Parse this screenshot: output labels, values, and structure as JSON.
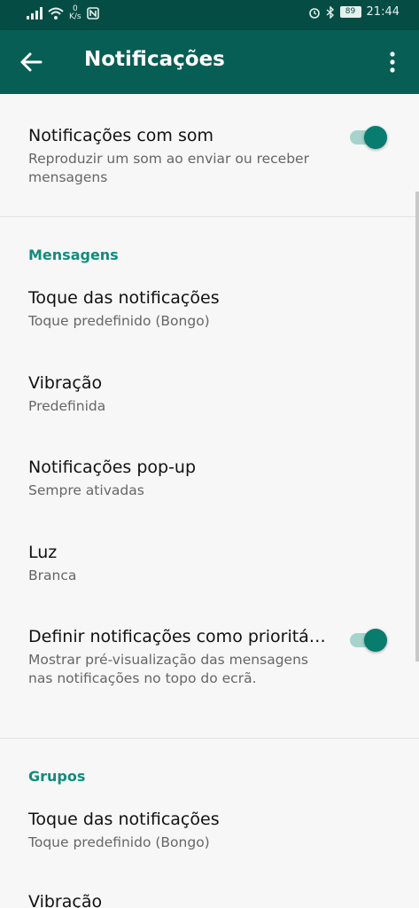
{
  "status_bar": {
    "net_speed_value": "0",
    "net_speed_unit": "K/s",
    "battery": "89",
    "time": "21:44"
  },
  "app_bar": {
    "title": "Notificações"
  },
  "colors": {
    "app_bar": "#075e54",
    "status_bar": "#054d44",
    "accent": "#128c7e",
    "toggle_track": "#a6d4cd",
    "toggle_thumb": "#087c6e"
  },
  "settings": {
    "sound": {
      "title": "Notificações com som",
      "subtitle": "Reproduzir um som ao enviar ou receber mensagens",
      "enabled": true
    },
    "messages": {
      "header": "Mensagens",
      "tone": {
        "title": "Toque das notificações",
        "value": "Toque predefinido (Bongo)"
      },
      "vibration": {
        "title": "Vibração",
        "value": "Predefinida"
      },
      "popup": {
        "title": "Notificações pop-up",
        "value": "Sempre ativadas"
      },
      "light": {
        "title": "Luz",
        "value": "Branca"
      },
      "priority": {
        "title": "Definir notificações como prioritá…",
        "subtitle": "Mostrar pré-visualização das mensagens nas notificações no topo do ecrã.",
        "enabled": true
      }
    },
    "groups": {
      "header": "Grupos",
      "tone": {
        "title": "Toque das notificações",
        "value": "Toque predefinido (Bongo)"
      },
      "vibration": {
        "title": "Vibração"
      }
    }
  }
}
